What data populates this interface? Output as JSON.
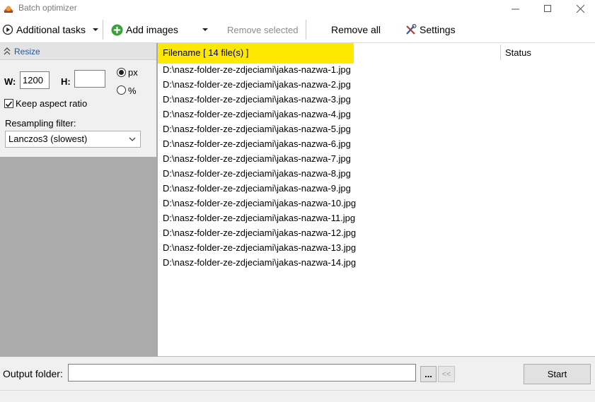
{
  "window": {
    "title": "Batch optimizer"
  },
  "toolbar": {
    "additional_tasks": "Additional tasks",
    "add_images": "Add images",
    "remove_selected": "Remove selected",
    "remove_all": "Remove all",
    "settings": "Settings"
  },
  "resize_panel": {
    "header": "Resize",
    "width_label": "W:",
    "width_value": "1200",
    "height_label": "H:",
    "height_value": "",
    "unit_px": "px",
    "unit_percent": "%",
    "selected_unit": "px",
    "keep_aspect_label": "Keep aspect ratio",
    "keep_aspect_checked": true,
    "filter_label": "Resampling filter:",
    "filter_value": "Lanczos3 (slowest)"
  },
  "file_list": {
    "filename_header": "Filename [ 14 file(s) ]",
    "status_header": "Status",
    "files": [
      "D:\\nasz-folder-ze-zdjeciami\\jakas-nazwa-1.jpg",
      "D:\\nasz-folder-ze-zdjeciami\\jakas-nazwa-2.jpg",
      "D:\\nasz-folder-ze-zdjeciami\\jakas-nazwa-3.jpg",
      "D:\\nasz-folder-ze-zdjeciami\\jakas-nazwa-4.jpg",
      "D:\\nasz-folder-ze-zdjeciami\\jakas-nazwa-5.jpg",
      "D:\\nasz-folder-ze-zdjeciami\\jakas-nazwa-6.jpg",
      "D:\\nasz-folder-ze-zdjeciami\\jakas-nazwa-7.jpg",
      "D:\\nasz-folder-ze-zdjeciami\\jakas-nazwa-8.jpg",
      "D:\\nasz-folder-ze-zdjeciami\\jakas-nazwa-9.jpg",
      "D:\\nasz-folder-ze-zdjeciami\\jakas-nazwa-10.jpg",
      "D:\\nasz-folder-ze-zdjeciami\\jakas-nazwa-11.jpg",
      "D:\\nasz-folder-ze-zdjeciami\\jakas-nazwa-12.jpg",
      "D:\\nasz-folder-ze-zdjeciami\\jakas-nazwa-13.jpg",
      "D:\\nasz-folder-ze-zdjeciami\\jakas-nazwa-14.jpg"
    ]
  },
  "bottom": {
    "output_label": "Output folder:",
    "output_value": "",
    "browse_label": "...",
    "back_label": "<<",
    "start_label": "Start"
  },
  "colors": {
    "header_highlight": "#ffe800",
    "left_panel_bg": "#ababab",
    "add_icon": "#3aa13a",
    "resize_link": "#1e5aa8"
  }
}
